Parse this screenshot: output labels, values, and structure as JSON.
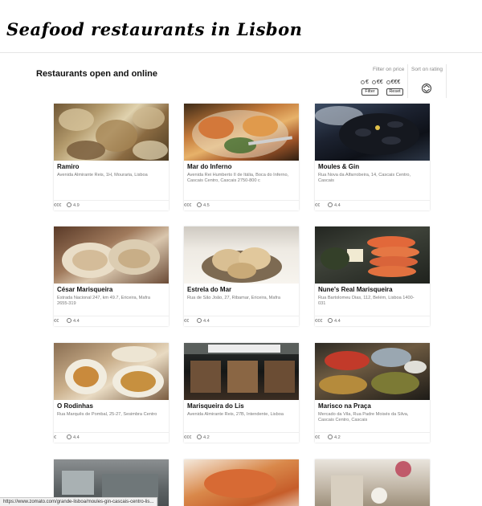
{
  "page": {
    "title": "Seafood restaurants in Lisbon",
    "subtitle": "Restaurants open and online"
  },
  "filter": {
    "label": "Filter on price",
    "options": [
      "€",
      "€€",
      "€€€"
    ],
    "filter_button": "Filter",
    "reset_button": "Reset"
  },
  "sort": {
    "label": "Sort on rating",
    "icon": "rating-sort-icon"
  },
  "restaurants": [
    {
      "name": "Ramiro",
      "address": "Avenida Almirante Reis, 1H, Mouraria, Lisboa",
      "price": "€€€",
      "rating": "4.9"
    },
    {
      "name": "Mar do Inferno",
      "address": "Avenida Rei Humberto II de Itália, Boca do Inferno, Cascais Centro, Cascais 2750-800 c",
      "price": "€€€",
      "rating": "4.5"
    },
    {
      "name": "Moules & Gin",
      "address": "Rua Nova da Alfarrobeira, 14, Cascais Centro, Cascais",
      "price": "€€",
      "rating": "4.4"
    },
    {
      "name": "César Marisqueira",
      "address": "Estrada Nacional 247, km 49.7, Ericeira, Mafra 2655-319",
      "price": "€€",
      "rating": "4.4"
    },
    {
      "name": "Estrela do Mar",
      "address": "Rua de São João, 27, Ribamar, Ericeira, Mafra",
      "price": "€€",
      "rating": "4.4"
    },
    {
      "name": "Nune's Real Marisqueira",
      "address": "Rua Bartolomeu Dias, 112, Belém, Lisboa 1400-031",
      "price": "€€€",
      "rating": "4.4"
    },
    {
      "name": "O Rodinhas",
      "address": "Rua Marquês de Pombal, 25-27, Sesimbra Centro",
      "price": "€",
      "rating": "4.4"
    },
    {
      "name": "Marisqueira do Lis",
      "address": "Avenida Almirante Reis, 27B, Intendente, Lisboa",
      "price": "€€€",
      "rating": "4.2"
    },
    {
      "name": "Marisco na Praça",
      "address": "Mercado da Vila, Rua Padre Moisés da Silva, Cascais Centro, Cascais",
      "price": "€€",
      "rating": "4.2"
    }
  ],
  "status_url": "https://www.zomato.com/grande-lisboa/moules-gin-cascais-centro-lis..."
}
